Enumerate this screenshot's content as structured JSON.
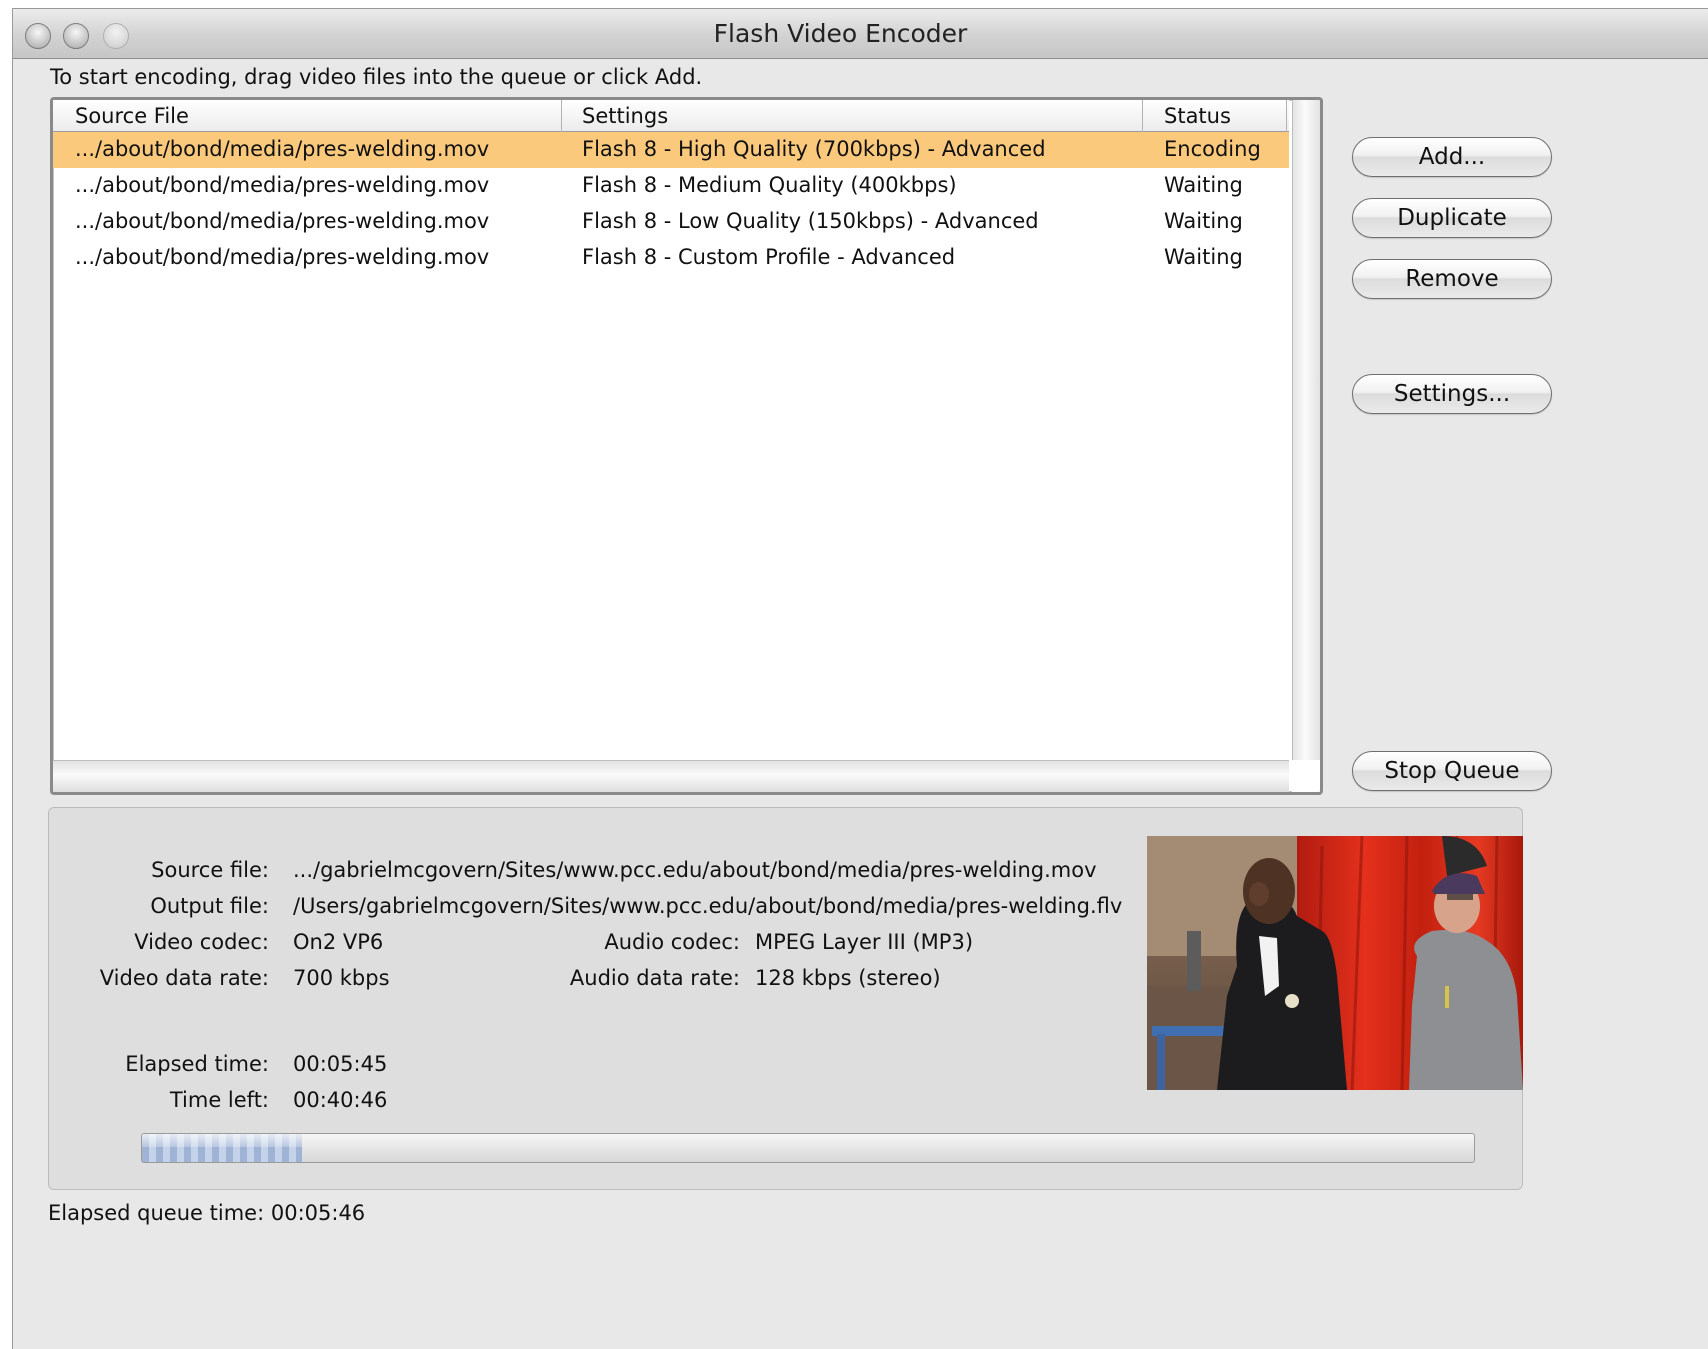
{
  "window": {
    "title": "Flash Video Encoder"
  },
  "instruction": "To start encoding, drag video files into the queue or click Add.",
  "queue": {
    "columns": [
      "Source File",
      "Settings",
      "Status"
    ],
    "rows": [
      {
        "source": ".../about/bond/media/pres-welding.mov",
        "settings": "Flash 8 - High Quality (700kbps) - Advanced",
        "status": "Encoding",
        "selected": true
      },
      {
        "source": ".../about/bond/media/pres-welding.mov",
        "settings": "Flash 8 - Medium Quality (400kbps)",
        "status": "Waiting",
        "selected": false
      },
      {
        "source": ".../about/bond/media/pres-welding.mov",
        "settings": "Flash 8 - Low Quality (150kbps) - Advanced",
        "status": "Waiting",
        "selected": false
      },
      {
        "source": ".../about/bond/media/pres-welding.mov",
        "settings": "Flash 8 - Custom Profile - Advanced",
        "status": "Waiting",
        "selected": false
      }
    ]
  },
  "buttons": {
    "add": "Add...",
    "duplicate": "Duplicate",
    "remove": "Remove",
    "settings": "Settings...",
    "stop_queue": "Stop Queue"
  },
  "details": {
    "source_file_label": "Source file:",
    "source_file": ".../gabrielmcgovern/Sites/www.pcc.edu/about/bond/media/pres-welding.mov",
    "output_file_label": "Output file:",
    "output_file": "/Users/gabrielmcgovern/Sites/www.pcc.edu/about/bond/media/pres-welding.flv",
    "video_codec_label": "Video codec:",
    "video_codec": "On2 VP6",
    "audio_codec_label": "Audio codec:",
    "audio_codec": "MPEG Layer III (MP3)",
    "video_data_rate_label": "Video data rate:",
    "video_data_rate": "700 kbps",
    "audio_data_rate_label": "Audio data rate:",
    "audio_data_rate": "128 kbps (stereo)",
    "elapsed_time_label": "Elapsed time:",
    "elapsed_time": "00:05:45",
    "time_left_label": "Time left:",
    "time_left": "00:40:46",
    "progress_fraction": 0.12
  },
  "footer": {
    "elapsed_queue_label": "Elapsed queue time:",
    "elapsed_queue_time": "00:05:46"
  },
  "colors": {
    "selection": "#fbc97c",
    "window_bg": "#e8e8e8",
    "panel_bg": "#dedede",
    "progress_blue": "#9fb3d4"
  },
  "icons": {
    "window_controls": [
      "close-button-icon",
      "minimize-button-icon",
      "zoom-button-icon"
    ],
    "preview": "video-preview-thumbnail"
  }
}
